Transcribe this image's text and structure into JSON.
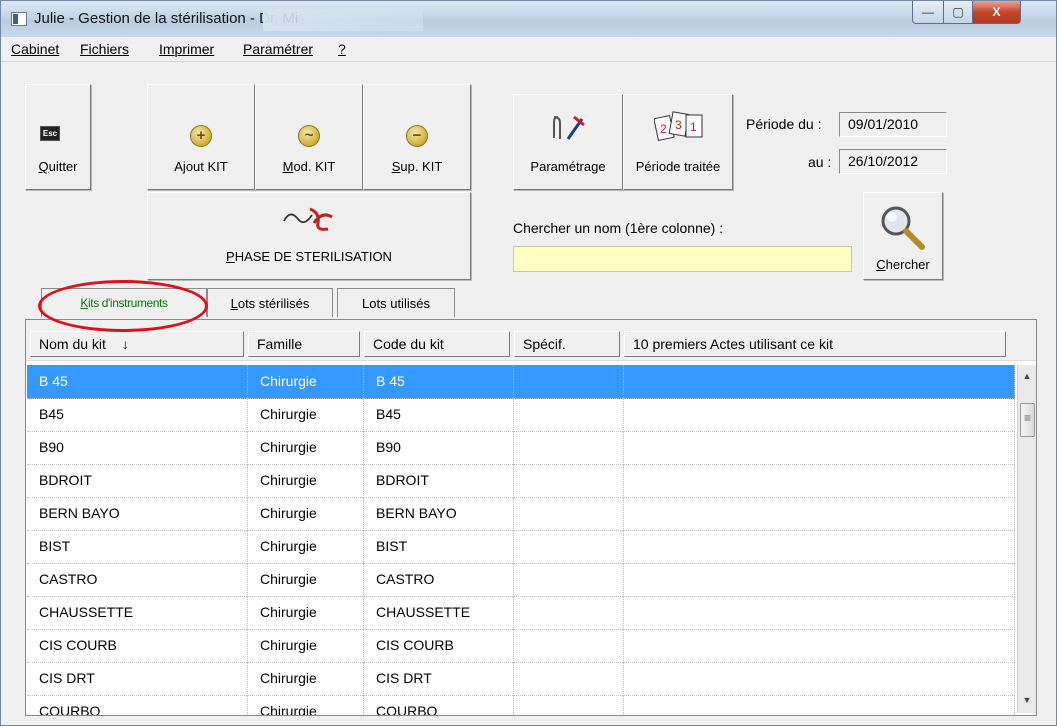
{
  "window": {
    "title": "Julie - Gestion de la stérilisation  - Dr. Mi",
    "controls": {
      "minimize": "—",
      "maximize": "▢",
      "close": "X"
    }
  },
  "menu": [
    "Cabinet",
    "Fichiers",
    "Imprimer",
    "Paramétrer",
    "?"
  ],
  "toolbar": {
    "quitter": "Quitter",
    "esc_key": "Esc",
    "ajout": "Ajout KIT",
    "mod": "Mod. KIT",
    "sup": "Sup. KIT",
    "parametrage": "Paramétrage",
    "periode_traitee": "Période traitée",
    "phase": "PHASE DE STERILISATION",
    "chercher": "Chercher"
  },
  "icons": {
    "quitter": "esc-key-icon",
    "ajout": "plus-circle-icon",
    "mod": "tilde-circle-icon",
    "sup": "minus-circle-icon",
    "parametrage": "tools-icon",
    "periode": "calendar-pages-icon",
    "phase": "sterilization-icon",
    "chercher": "magnifier-icon"
  },
  "period": {
    "from_label": "Période du :",
    "from_value": "09/01/2010",
    "to_label": "au :",
    "to_value": "26/10/2012"
  },
  "search": {
    "label": "Chercher un nom (1ère colonne) :",
    "value": ""
  },
  "tabs": [
    "Kits d'instruments",
    "Lots stérilisés",
    "Lots utilisés"
  ],
  "active_tab": 0,
  "table": {
    "headers": [
      "Nom du kit",
      "Famille",
      "Code du kit",
      "Spécif.",
      "10 premiers Actes utilisant ce kit"
    ],
    "sort_indicator": "↓",
    "rows": [
      [
        "B 45",
        "Chirurgie",
        "B 45",
        "",
        ""
      ],
      [
        "B45",
        "Chirurgie",
        "B45",
        "",
        ""
      ],
      [
        "B90",
        "Chirurgie",
        "B90",
        "",
        ""
      ],
      [
        "BDROIT",
        "Chirurgie",
        "BDROIT",
        "",
        ""
      ],
      [
        "BERN BAYO",
        "Chirurgie",
        "BERN BAYO",
        "",
        ""
      ],
      [
        "BIST",
        "Chirurgie",
        "BIST",
        "",
        ""
      ],
      [
        "CASTRO",
        "Chirurgie",
        "CASTRO",
        "",
        ""
      ],
      [
        "CHAUSSETTE",
        "Chirurgie",
        "CHAUSSETTE",
        "",
        ""
      ],
      [
        "CIS COURB",
        "Chirurgie",
        "CIS COURB",
        "",
        ""
      ],
      [
        "CIS DRT",
        "Chirurgie",
        "CIS DRT",
        "",
        ""
      ],
      [
        "COURBO",
        "Chirurgie",
        "COURBO",
        "",
        ""
      ]
    ],
    "selected_row": 0
  },
  "colors": {
    "selection": "#3399ff",
    "search_bg": "#ffffc4",
    "highlight_ring": "#e0101a",
    "active_tab_text": "#008000"
  }
}
